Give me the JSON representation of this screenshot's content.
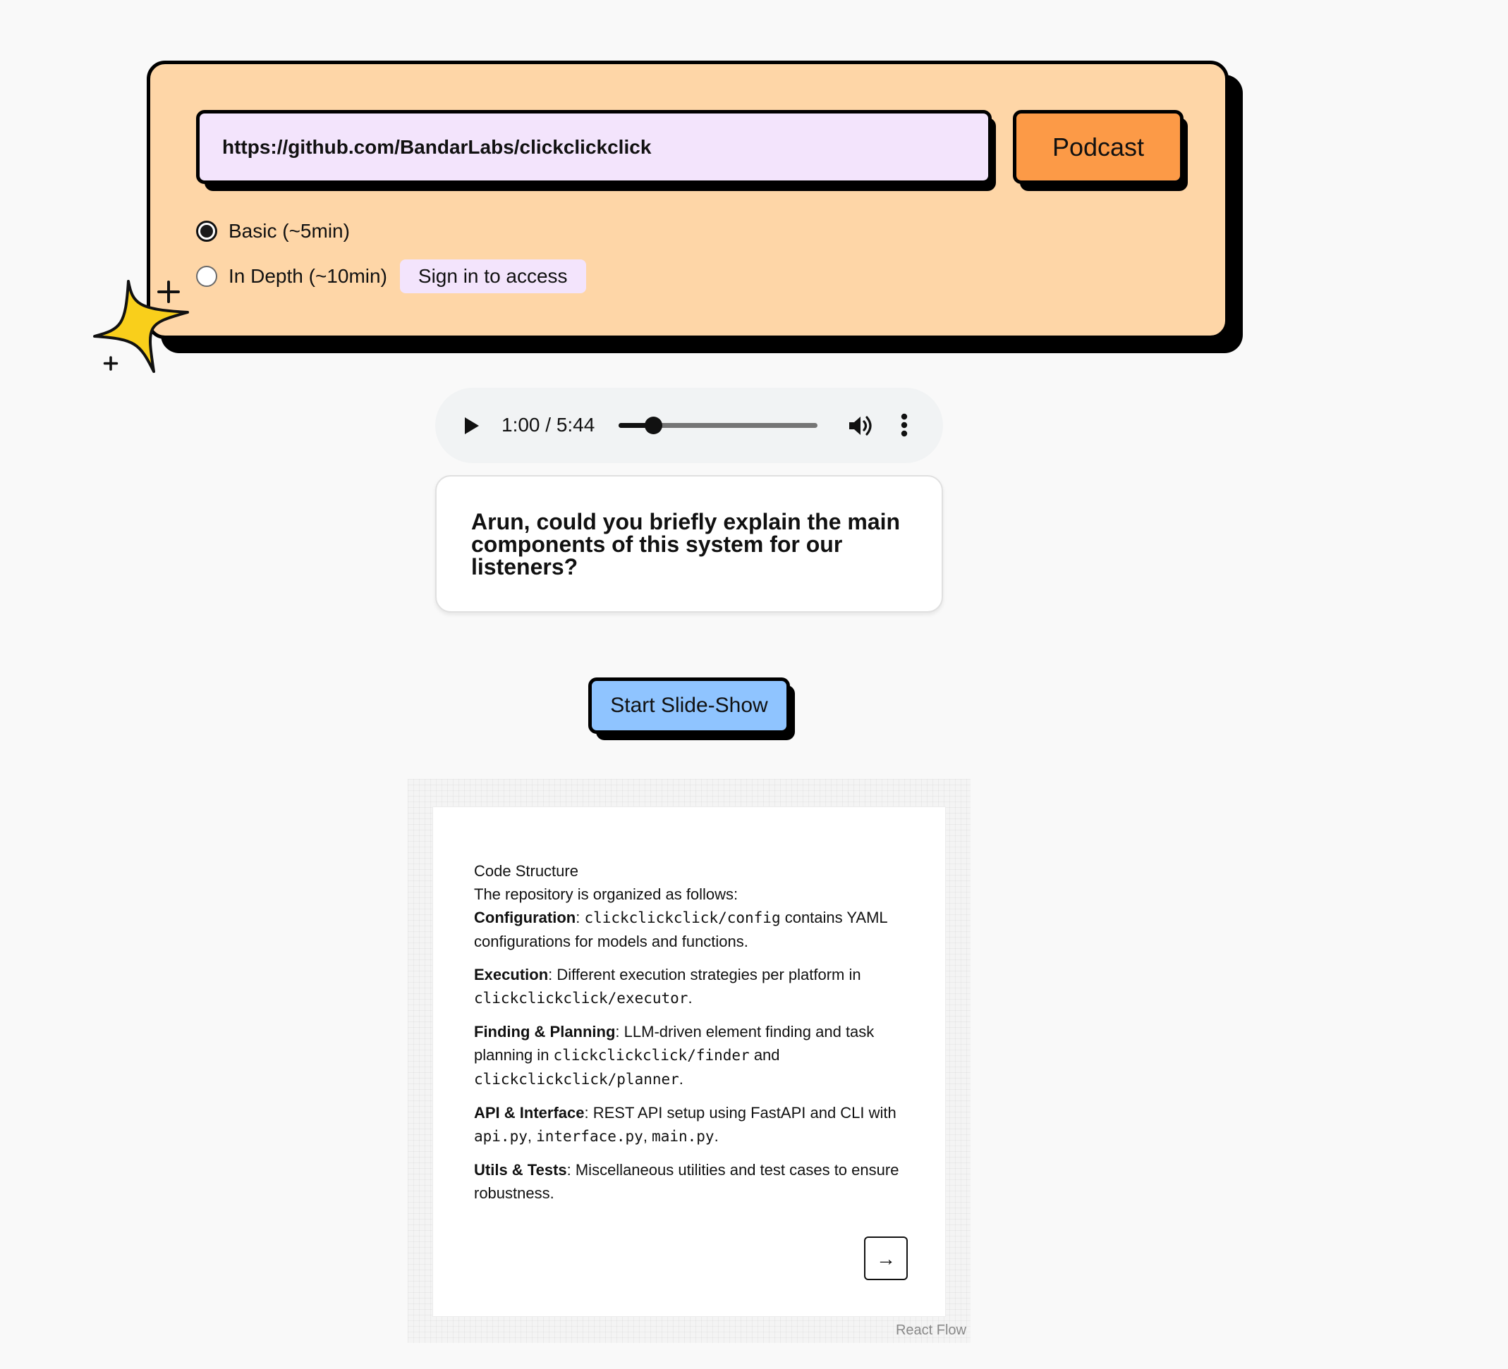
{
  "form": {
    "url_value": "https://github.com/BandarLabs/clickclickclick",
    "submit_label": "Podcast",
    "options": [
      {
        "label": "Basic (~5min)",
        "selected": true
      },
      {
        "label": "In Depth (~10min)",
        "selected": false,
        "badge": "Sign in to access"
      }
    ]
  },
  "player": {
    "time_display": "1:00 / 5:44",
    "progress_fraction": 0.1744
  },
  "caption": {
    "text": "Arun, could you briefly explain the main components of this system for our listeners?"
  },
  "slideshow_button": {
    "label": "Start Slide-Show"
  },
  "slide": {
    "title": "Code Structure",
    "intro": "The repository is organized as follows:",
    "items": [
      {
        "label": "Configuration",
        "parts": [
          ": ",
          "clickclickclick/config",
          " contains YAML configurations for models and functions."
        ]
      },
      {
        "label": "Execution",
        "parts": [
          ": Different execution strategies per platform in ",
          "clickclickclick/executor",
          "."
        ]
      },
      {
        "label": "Finding & Planning",
        "parts": [
          ": LLM-driven element finding and task planning in ",
          "clickclickclick/finder",
          " and ",
          "clickclickclick/planner",
          "."
        ]
      },
      {
        "label": "API & Interface",
        "parts": [
          ": REST API setup using FastAPI and CLI with ",
          "api.py",
          ", ",
          "interface.py",
          ", ",
          "main.py",
          "."
        ]
      },
      {
        "label": "Utils & Tests",
        "parts": [
          ": Miscellaneous utilities and test cases to ensure robustness."
        ]
      }
    ],
    "next_glyph": "→"
  },
  "attribution": "React Flow",
  "icons": {
    "play": "play-icon",
    "volume": "volume-icon",
    "more": "more-vertical-icon",
    "sparkle": "sparkle-star-icon",
    "next": "arrow-right-icon"
  },
  "colors": {
    "card_bg": "#fed6a7",
    "input_bg": "#f3e4fc",
    "podcast_btn": "#fc9a47",
    "slideshow_btn": "#8fc4ff",
    "star": "#f9cf1b"
  }
}
